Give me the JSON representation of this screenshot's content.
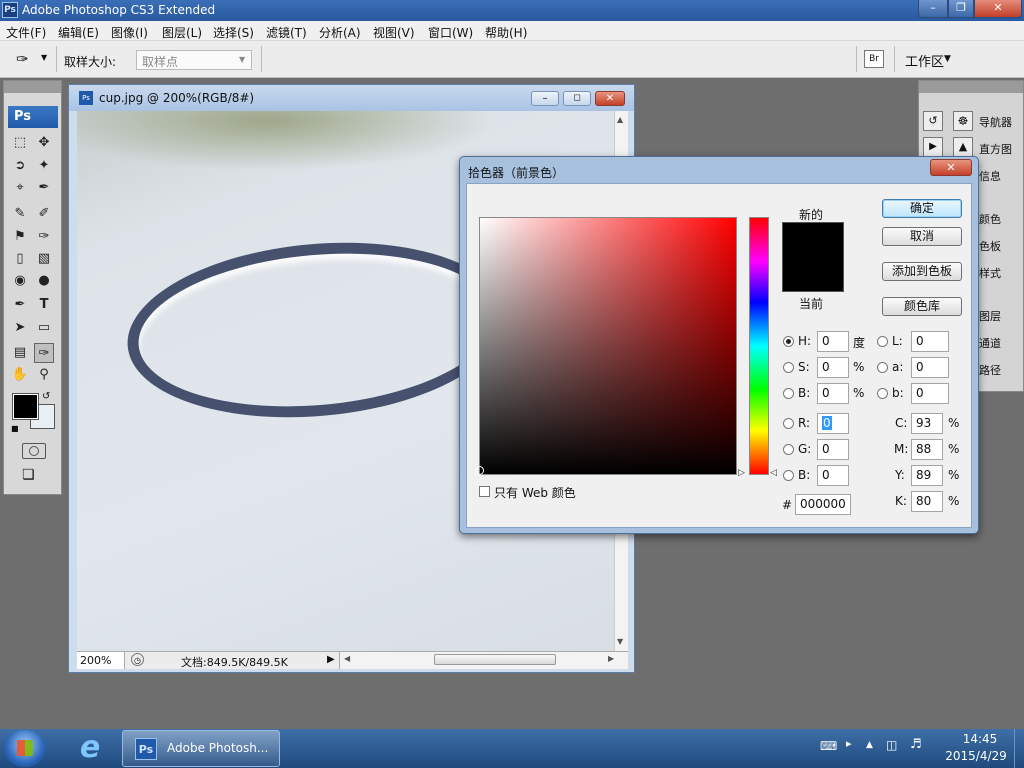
{
  "app": {
    "title": "Adobe Photoshop CS3 Extended",
    "logo": "Ps"
  },
  "menu": [
    "文件(F)",
    "编辑(E)",
    "图像(I)",
    "图层(L)",
    "选择(S)",
    "滤镜(T)",
    "分析(A)",
    "视图(V)",
    "窗口(W)",
    "帮助(H)"
  ],
  "options": {
    "sample_size_label": "取样大小:",
    "sample_size_value": "取样点",
    "workspace_label": "工作区"
  },
  "tools": {
    "logo": "Ps"
  },
  "document": {
    "title": "cup.jpg @ 200%(RGB/8#)",
    "zoom": "200%",
    "doc_info": "文档:849.5K/849.5K"
  },
  "panels": {
    "items": [
      "导航器",
      "直方图",
      "信息",
      "颜色",
      "色板",
      "样式",
      "图层",
      "通道",
      "路径"
    ]
  },
  "picker": {
    "title": "拾色器（前景色）",
    "new_label": "新的",
    "current_label": "当前",
    "buttons": {
      "ok": "确定",
      "cancel": "取消",
      "add_swatch": "添加到色板",
      "libraries": "颜色库"
    },
    "hsb": [
      {
        "label": "H:",
        "value": "0",
        "unit": "度"
      },
      {
        "label": "S:",
        "value": "0",
        "unit": "%"
      },
      {
        "label": "B:",
        "value": "0",
        "unit": "%"
      }
    ],
    "rgb": [
      {
        "label": "R:",
        "value": "0"
      },
      {
        "label": "G:",
        "value": "0"
      },
      {
        "label": "B:",
        "value": "0"
      }
    ],
    "lab": [
      {
        "label": "L:",
        "value": "0"
      },
      {
        "label": "a:",
        "value": "0"
      },
      {
        "label": "b:",
        "value": "0"
      }
    ],
    "cmyk": [
      {
        "label": "C:",
        "value": "93",
        "unit": "%"
      },
      {
        "label": "M:",
        "value": "88",
        "unit": "%"
      },
      {
        "label": "Y:",
        "value": "89",
        "unit": "%"
      },
      {
        "label": "K:",
        "value": "80",
        "unit": "%"
      }
    ],
    "hex_label": "#",
    "hex_value": "000000",
    "web_only_label": "只有 Web 颜色",
    "new_color": "#000000",
    "current_color": "#000000"
  },
  "taskbar": {
    "task_label": "Adobe Photosh...",
    "time": "14:45",
    "date": "2015/4/29"
  }
}
